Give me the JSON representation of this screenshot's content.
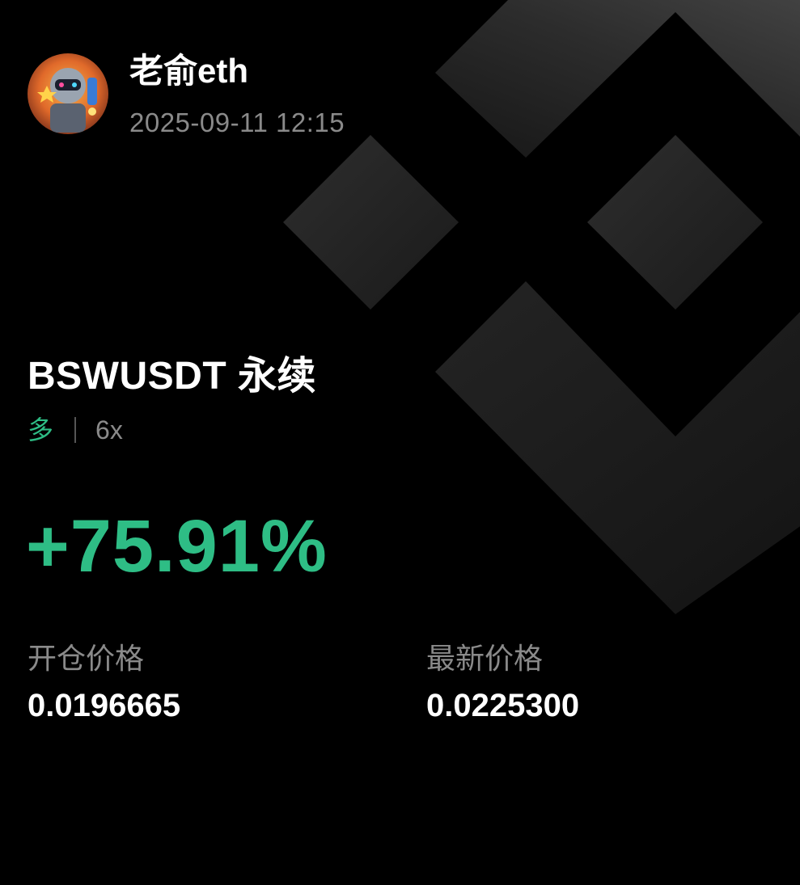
{
  "user": {
    "name": "老俞eth",
    "timestamp": "2025-09-11 12:15"
  },
  "position": {
    "pair": "BSWUSDT 永续",
    "direction": "多",
    "leverage": "6x",
    "pnl_percent": "+75.91%"
  },
  "prices": {
    "entry_label": "开仓价格",
    "entry_value": "0.0196665",
    "latest_label": "最新价格",
    "latest_value": "0.0225300"
  },
  "colors": {
    "background": "#000000",
    "profit_green": "#2ebd85",
    "muted_gray": "#8a8a8a"
  },
  "icons": {
    "background_logo": "binance-logo-icon",
    "avatar": "robot-avatar"
  }
}
